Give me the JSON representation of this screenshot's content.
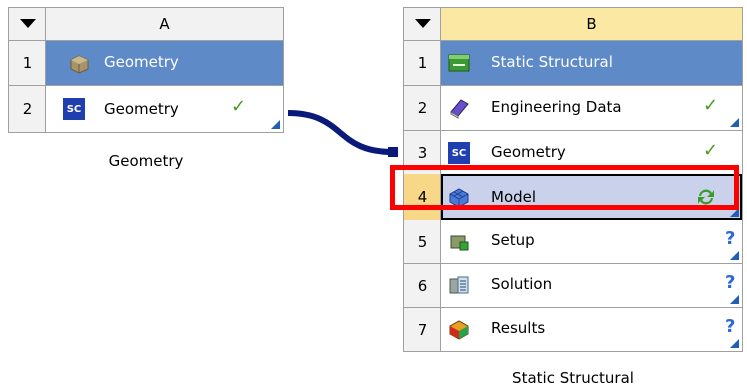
{
  "system_a": {
    "column_letter": "A",
    "caption": "Geometry",
    "rows": [
      {
        "num": "1",
        "label": "Geometry",
        "icon": "geometry-block-icon",
        "status": ""
      },
      {
        "num": "2",
        "label": "Geometry",
        "icon": "spaceclaim-sc-icon",
        "status": "check-icon"
      }
    ]
  },
  "system_b": {
    "column_letter": "B",
    "caption": "Static Structural",
    "rows": [
      {
        "num": "1",
        "label": "Static Structural",
        "icon": "static-structural-icon",
        "status": ""
      },
      {
        "num": "2",
        "label": "Engineering Data",
        "icon": "engineering-data-book-icon",
        "status": "check-icon"
      },
      {
        "num": "3",
        "label": "Geometry",
        "icon": "spaceclaim-sc-icon",
        "status": "check-icon"
      },
      {
        "num": "4",
        "label": "Model",
        "icon": "model-mesh-icon",
        "status": "refresh-required-icon"
      },
      {
        "num": "5",
        "label": "Setup",
        "icon": "setup-icon",
        "status": "question-icon"
      },
      {
        "num": "6",
        "label": "Solution",
        "icon": "solution-icon",
        "status": "question-icon"
      },
      {
        "num": "7",
        "label": "Results",
        "icon": "results-icon",
        "status": "question-icon"
      }
    ]
  },
  "colors": {
    "selected_row": "#5e8ac8",
    "model_row": "#c9d2ea",
    "highlight_box": "#ff0000",
    "connector": "#0a1a7a",
    "check": "#4a9a2a",
    "question": "#2a6ad8",
    "corner_arrow": "#1f5fb8",
    "header_b": "#fbe8a3"
  },
  "sc_text": "SC"
}
